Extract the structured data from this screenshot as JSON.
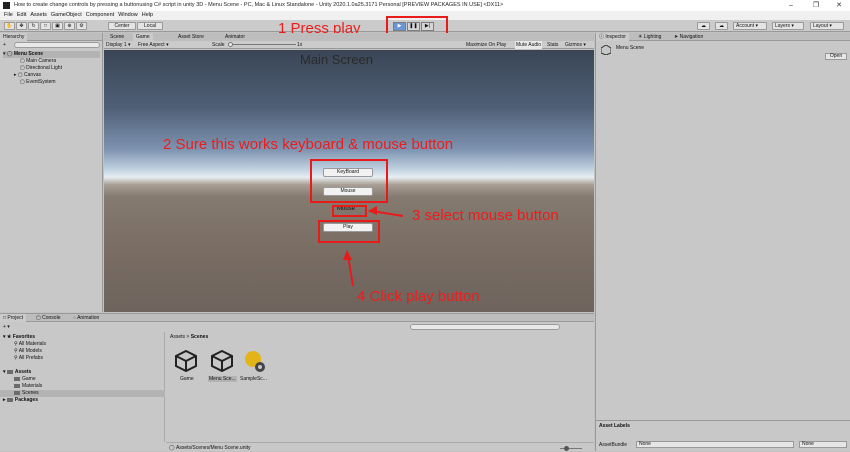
{
  "window": {
    "title": "How to create change controls by pressing a buttonusing C# script in unity 3D - Menu Scene - PC, Mac & Linux Standalone - Unity 2020.1.0a25.3171 Personal [PREVIEW PACKAGES IN USE] <DX11>"
  },
  "menu": [
    "File",
    "Edit",
    "Assets",
    "GameObject",
    "Component",
    "Window",
    "Help"
  ],
  "toolbar": {
    "center_label": "Center",
    "local_label": "Local",
    "account_label": "Account",
    "layers_label": "Layers",
    "layout_label": "Layout"
  },
  "hierarchy": {
    "tab": "Hierarchy",
    "add_label": "+",
    "search_placeholder": "All",
    "scene": "Menu Scene",
    "items": [
      "Main Camera",
      "Directional Light",
      "Canvas",
      "EventSystem"
    ]
  },
  "scene_tabs": [
    "Scene",
    "Game",
    "Asset Store",
    "Animator"
  ],
  "game_toolbar": {
    "display": "Display 1",
    "aspect": "Free Aspect",
    "scale_label": "Scale",
    "scale_value": "1x",
    "maximize": "Maximize On Play",
    "mute": "Mute Audio",
    "stats": "Stats",
    "gizmos": "Gizmos"
  },
  "game_view": {
    "title": "Main Screen",
    "keyboard_button": "KeyBoard",
    "mouse_button": "Mouse",
    "mouse_label": "Mouse",
    "play_button": "Play"
  },
  "annotations": {
    "step1": "1 Press play",
    "step2": "2 Sure this works keyboard & mouse button",
    "step3": "3 select mouse button",
    "step4": "4 Click play button"
  },
  "inspector": {
    "tabs": [
      "Inspector",
      "Lighting",
      "Navigation"
    ],
    "object_name": "Menu Scene",
    "open_button": "Open",
    "asset_labels": "Asset Labels",
    "assetbundle_label": "AssetBundle",
    "assetbundle_value": "None",
    "variant_value": "None"
  },
  "project": {
    "tabs": [
      "Project",
      "Console",
      "Animation"
    ],
    "favorites_label": "Favorites",
    "favorites": [
      "All Materials",
      "All Models",
      "All Prefabs"
    ],
    "assets_label": "Assets",
    "assets": [
      "Game",
      "Materials",
      "Scenes"
    ],
    "packages_label": "Packages",
    "breadcrumb_root": "Assets",
    "breadcrumb_sep": ">",
    "breadcrumb_current": "Scenes",
    "files": [
      "Game",
      "Menu Sce...",
      "SampleSc..."
    ],
    "status_path": "Assets/Scenes/Menu Scene.unity"
  }
}
